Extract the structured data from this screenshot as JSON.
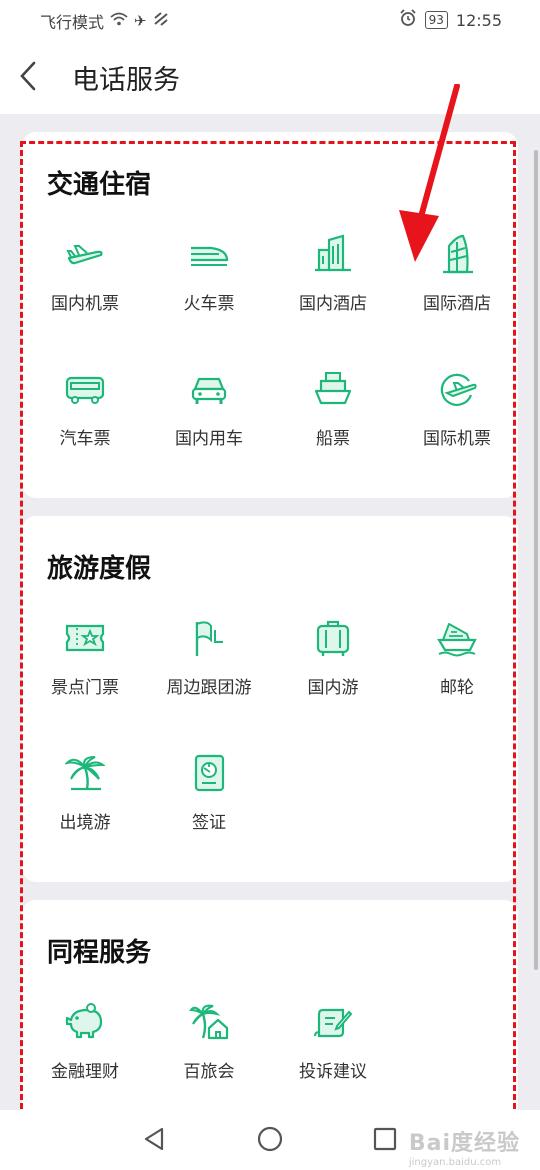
{
  "status_bar": {
    "mode": "飞行模式",
    "battery": "93",
    "time": "12:55"
  },
  "header": {
    "title": "电话服务"
  },
  "sections": [
    {
      "title": "交通住宿",
      "items": [
        {
          "label": "国内机票",
          "icon": "plane-icon"
        },
        {
          "label": "火车票",
          "icon": "train-icon"
        },
        {
          "label": "国内酒店",
          "icon": "hotel-building-icon"
        },
        {
          "label": "国际酒店",
          "icon": "sail-hotel-icon"
        },
        {
          "label": "汽车票",
          "icon": "bus-icon"
        },
        {
          "label": "国内用车",
          "icon": "car-icon"
        },
        {
          "label": "船票",
          "icon": "ship-icon"
        },
        {
          "label": "国际机票",
          "icon": "globe-plane-icon"
        }
      ]
    },
    {
      "title": "旅游度假",
      "items": [
        {
          "label": "景点门票",
          "icon": "ticket-icon"
        },
        {
          "label": "周边跟团游",
          "icon": "flag-icon"
        },
        {
          "label": "国内游",
          "icon": "luggage-icon"
        },
        {
          "label": "邮轮",
          "icon": "cruise-icon"
        },
        {
          "label": "出境游",
          "icon": "palm-icon"
        },
        {
          "label": "签证",
          "icon": "passport-icon"
        }
      ]
    },
    {
      "title": "同程服务",
      "items": [
        {
          "label": "金融理财",
          "icon": "piggy-bank-icon"
        },
        {
          "label": "百旅会",
          "icon": "palm-house-icon"
        },
        {
          "label": "投诉建议",
          "icon": "feedback-icon"
        }
      ]
    }
  ],
  "watermark": {
    "brand": "Bai度经验",
    "url": "jingyan.baidu.com"
  },
  "colors": {
    "accent": "#1db779",
    "annotation": "#e4141c",
    "arrow": "#e8141c"
  }
}
